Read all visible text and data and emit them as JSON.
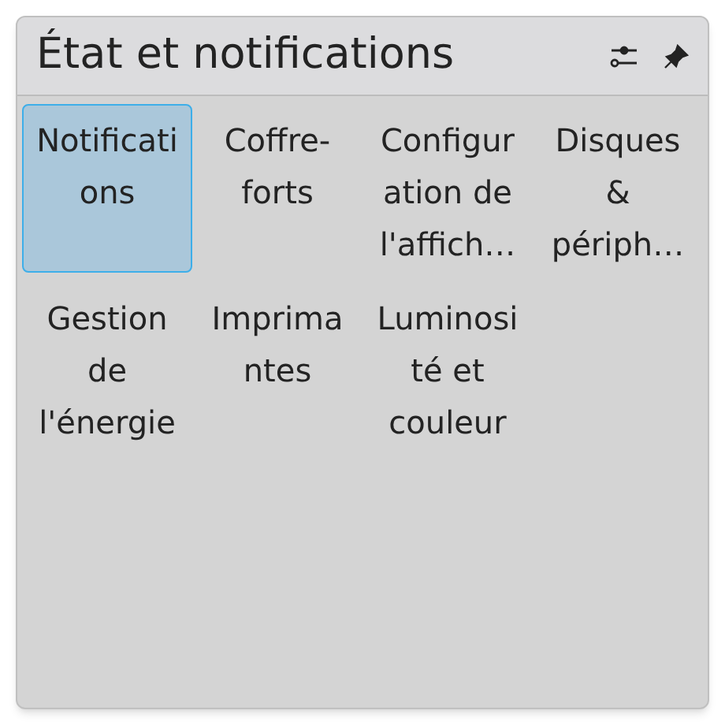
{
  "window": {
    "title": "État et notifications"
  },
  "items": [
    {
      "label_lines": [
        "Notificati",
        "ons"
      ],
      "selected": true
    },
    {
      "label_lines": [
        "Coffre-",
        "forts"
      ],
      "selected": false
    },
    {
      "label_lines": [
        "Configur",
        "ation de",
        "l'affich…"
      ],
      "selected": false
    },
    {
      "label_lines": [
        "Disques",
        "&",
        "périph…"
      ],
      "selected": false
    },
    {
      "label_lines": [
        "Gestion",
        "de",
        "l'énergie"
      ],
      "selected": false
    },
    {
      "label_lines": [
        "Imprima",
        "ntes"
      ],
      "selected": false
    },
    {
      "label_lines": [
        "Luminosi",
        "té et",
        "couleur"
      ],
      "selected": false
    }
  ]
}
